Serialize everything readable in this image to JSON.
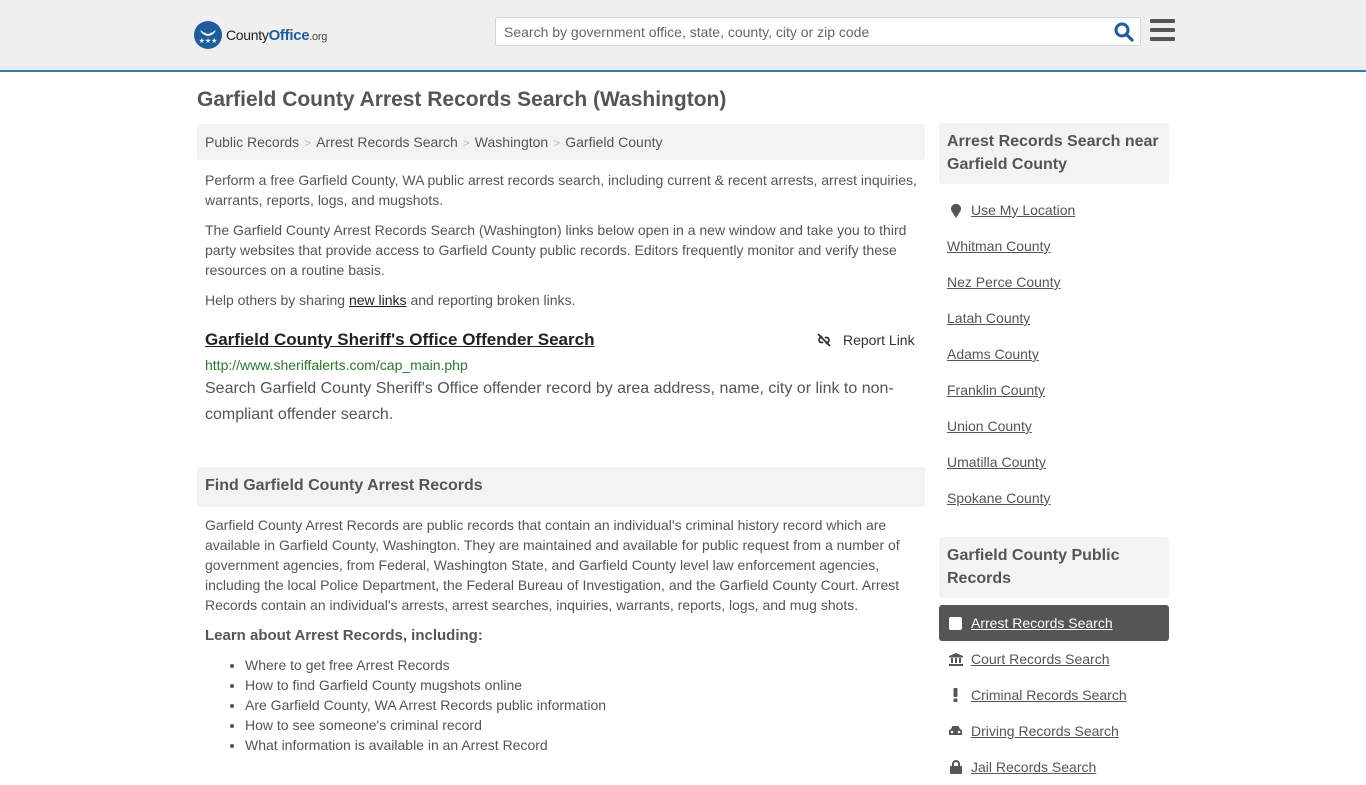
{
  "header": {
    "logo": {
      "part1": "County",
      "part2": "Office",
      "part3": ".org"
    },
    "search_placeholder": "Search by government office, state, county, city or zip code",
    "colors": {
      "brand": "#1f5c9e",
      "border": "#3b7bab"
    }
  },
  "page_title": "Garfield County Arrest Records Search (Washington)",
  "breadcrumb": [
    "Public Records",
    "Arrest Records Search",
    "Washington",
    "Garfield County"
  ],
  "intro": {
    "p1": "Perform a free Garfield County, WA public arrest records search, including current & recent arrests, arrest inquiries, warrants, reports, logs, and mugshots.",
    "p2": "The Garfield County Arrest Records Search (Washington) links below open in a new window and take you to third party websites that provide access to Garfield County public records. Editors frequently monitor and verify these resources on a routine basis.",
    "p3_before": "Help others by sharing ",
    "p3_link": "new links",
    "p3_after": " and reporting broken links."
  },
  "result": {
    "title": "Garfield County Sheriff's Office Offender Search",
    "report_label": "Report Link",
    "url": "http://www.sheriffalerts.com/cap_main.php",
    "description": "Search Garfield County Sheriff's Office offender record by area address, name, city or link to non-compliant offender search."
  },
  "find_section": {
    "heading": "Find Garfield County Arrest Records",
    "body": "Garfield County Arrest Records are public records that contain an individual's criminal history record which are available in Garfield County, Washington. They are maintained and available for public request from a number of government agencies, from Federal, Washington State, and Garfield County level law enforcement agencies, including the local Police Department, the Federal Bureau of Investigation, and the Garfield County Court. Arrest Records contain an individual's arrests, arrest searches, inquiries, warrants, reports, logs, and mug shots.",
    "learn_heading": "Learn about Arrest Records, including:",
    "learn_items": [
      "Where to get free Arrest Records",
      "How to find Garfield County mugshots online",
      "Are Garfield County, WA Arrest Records public information",
      "How to see someone's criminal record",
      "What information is available in an Arrest Record"
    ]
  },
  "sidebar": {
    "nearby_heading": "Arrest Records Search near Garfield County",
    "use_location": "Use My Location",
    "nearby": [
      "Whitman County",
      "Nez Perce County",
      "Latah County",
      "Adams County",
      "Franklin County",
      "Union County",
      "Umatilla County",
      "Spokane County"
    ],
    "public_heading": "Garfield County Public Records",
    "public_items": [
      {
        "label": "Arrest Records Search",
        "icon": "square-icon",
        "active": true
      },
      {
        "label": "Court Records Search",
        "icon": "courthouse-icon",
        "active": false
      },
      {
        "label": "Criminal Records Search",
        "icon": "exclamation-icon",
        "active": false
      },
      {
        "label": "Driving Records Search",
        "icon": "car-icon",
        "active": false
      },
      {
        "label": "Jail Records Search",
        "icon": "lock-icon",
        "active": false
      }
    ]
  }
}
